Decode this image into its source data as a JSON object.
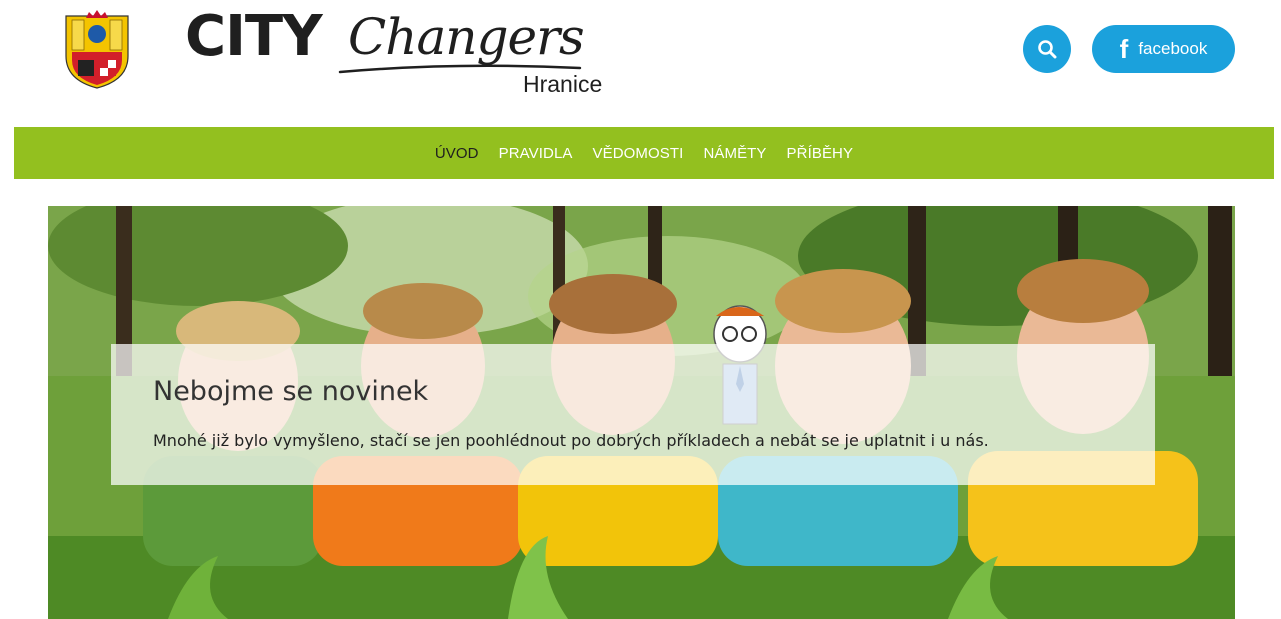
{
  "header": {
    "crest_icon": "city-coat-of-arms-icon",
    "logo": {
      "part1": "CITY",
      "part2": "Changers",
      "city": "Hranice"
    },
    "search_icon": "search-icon",
    "facebook": {
      "icon": "facebook-icon",
      "label": "facebook"
    }
  },
  "nav": {
    "items": [
      {
        "label": "ÚVOD",
        "active": true
      },
      {
        "label": "PRAVIDLA",
        "active": false
      },
      {
        "label": "VĚDOMOSTI",
        "active": false
      },
      {
        "label": "NÁMĚTY",
        "active": false
      },
      {
        "label": "PŘÍBĚHY",
        "active": false
      }
    ]
  },
  "hero": {
    "image": "children-lying-on-grass-photo",
    "mascot_icon": "cartoon-boy-with-glasses-icon",
    "title": "Nebojme se novinek",
    "text": "Mnohé již bylo vymyšleno, stačí se jen poohlédnout po dobrých příkladech a nebát se je uplatnit i u nás."
  },
  "colors": {
    "nav_bg": "#93c01f",
    "accent_blue": "#1ba1dc",
    "active_nav_text": "#1f1f1f"
  }
}
